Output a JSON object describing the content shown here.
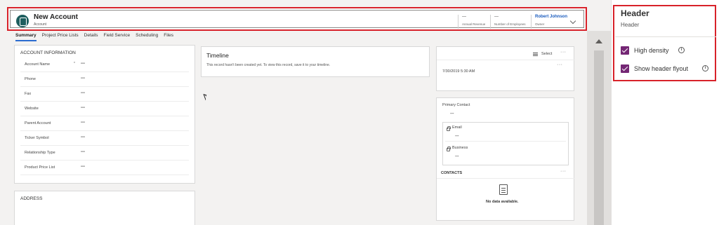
{
  "record": {
    "title": "New Account",
    "entity": "Account"
  },
  "header_fields": [
    {
      "value": "---",
      "label": "Annual Revenue"
    },
    {
      "value": "---",
      "label": "Number of Employees"
    },
    {
      "value": "Robert Johnson",
      "label": "Owner"
    }
  ],
  "tabs": [
    "Summary",
    "Project Price Lists",
    "Details",
    "Field Service",
    "Scheduling",
    "Files"
  ],
  "account_info": {
    "title": "ACCOUNT INFORMATION",
    "fields": [
      {
        "label": "Account Name",
        "required": "*",
        "value": "---"
      },
      {
        "label": "Phone",
        "value": "---"
      },
      {
        "label": "Fax",
        "value": "---"
      },
      {
        "label": "Website",
        "value": "---"
      },
      {
        "label": "Parent Account",
        "value": "---"
      },
      {
        "label": "Ticker Symbol",
        "value": "---"
      },
      {
        "label": "Relationship Type",
        "value": "---"
      },
      {
        "label": "Product Price List",
        "value": "---"
      }
    ]
  },
  "address": {
    "title": "ADDRESS"
  },
  "timeline": {
    "title": "Timeline",
    "message": "This record hasn't been created yet.  To view this record, save it to your timeline."
  },
  "activity": {
    "select_label": "Select",
    "more": "···",
    "timestamp": "7/30/2019 5:30 AM"
  },
  "contact": {
    "primary_label": "Primary Contact",
    "primary_value": "---",
    "email_label": "Email",
    "email_value": "---",
    "business_label": "Business",
    "business_value": "---",
    "contacts_title": "CONTACTS",
    "more": "···",
    "empty": "No data available."
  },
  "panel": {
    "title": "Header",
    "subtitle": "Header",
    "options": [
      {
        "label": "High density",
        "checked": true
      },
      {
        "label": "Show header flyout",
        "checked": true
      }
    ]
  },
  "colors": {
    "highlight": "#d8222a",
    "checkbox": "#742774",
    "entity_icon": "#1e5e5e",
    "link": "#1a5bbd"
  }
}
